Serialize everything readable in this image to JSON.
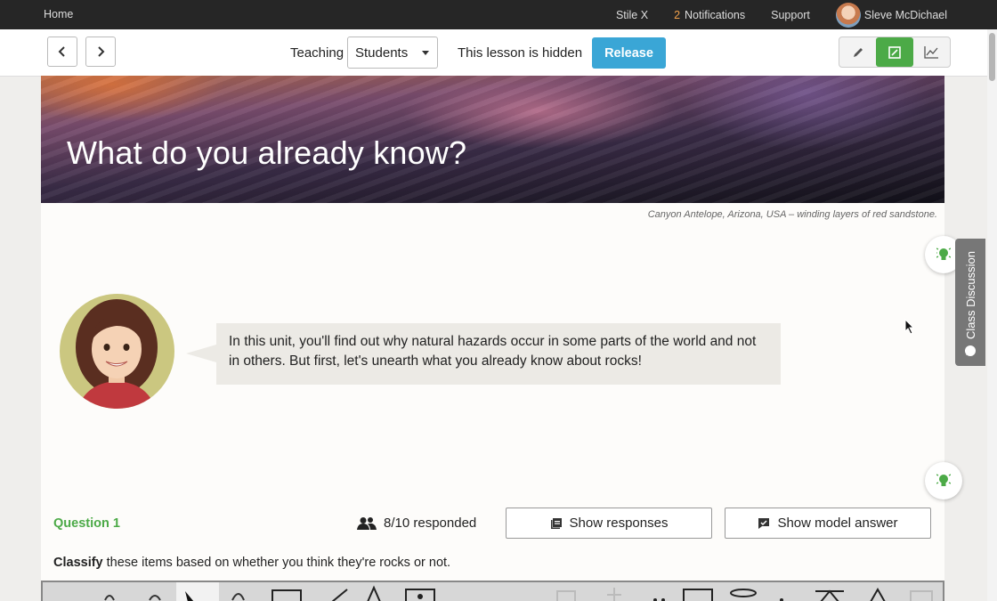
{
  "topnav": {
    "home": "Home",
    "stile_x": "Stile X",
    "notifications_count": "2",
    "notifications": "Notifications",
    "support": "Support",
    "user_name": "Sleve McDichael"
  },
  "toolbar": {
    "teaching_label": "Teaching",
    "audience_selected": "Students",
    "hidden_status": "This lesson is hidden",
    "release_label": "Release",
    "accent_color": "#3aa6d6",
    "active_view_color": "#4caa47"
  },
  "hero": {
    "title": "What do you already know?",
    "caption": "Canyon Antelope, Arizona, USA – winding layers of red sandstone."
  },
  "intro": {
    "text": "In this unit, you'll find out why natural hazards occur in some parts of the world and not in others. But first, let's unearth what you already know about rocks!"
  },
  "question": {
    "label": "Question 1",
    "responded": "8/10 responded",
    "show_responses": "Show responses",
    "show_model_answer": "Show model answer",
    "instruction_bold": "Classify",
    "instruction_rest": " these items based on whether you think they're rocks or not."
  },
  "side": {
    "class_discussion": "Class Discussion"
  }
}
